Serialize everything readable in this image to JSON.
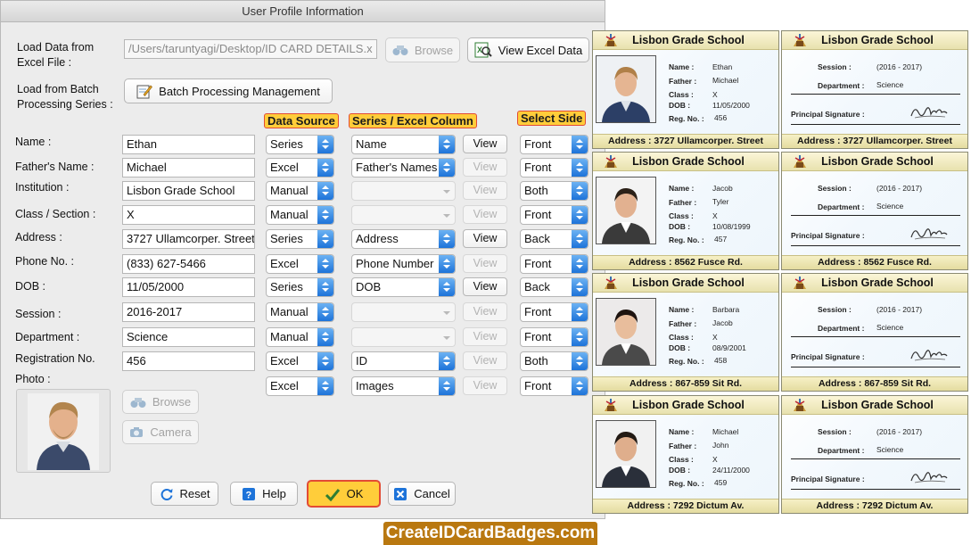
{
  "window": {
    "title": "User Profile Information"
  },
  "load_excel": {
    "label_line1": "Load Data from",
    "label_line2": "Excel File :",
    "path": "/Users/taruntyagi/Desktop/ID CARD DETAILS.x",
    "browse_label": "Browse",
    "view_label": "View Excel Data"
  },
  "batch": {
    "label_line1": "Load from Batch",
    "label_line2": "Processing Series :",
    "button_label": "Batch Processing Management"
  },
  "headers": {
    "data_source": "Data Source",
    "series_column": "Series / Excel Column",
    "select_side": "Select Side"
  },
  "fields": [
    {
      "label": "Name :",
      "value": "Ethan",
      "source": "Series",
      "column": "Name",
      "view": "View",
      "side": "Front"
    },
    {
      "label": "Father's Name :",
      "value": "Michael",
      "source": "Excel",
      "column": "Father's Names",
      "view": "View",
      "side": "Front"
    },
    {
      "label": "Institution :",
      "value": "Lisbon Grade School",
      "source": "Manual",
      "column": "",
      "view": "View",
      "side": "Both"
    },
    {
      "label": "Class / Section :",
      "value": "X",
      "source": "Manual",
      "column": "",
      "view": "View",
      "side": "Front"
    },
    {
      "label": "Address :",
      "value": "3727 Ullamcorper. Street",
      "source": "Series",
      "column": "Address",
      "view": "View",
      "side": "Back"
    },
    {
      "label": "Phone No. :",
      "value": "(833) 627-5466",
      "source": "Excel",
      "column": "Phone Number",
      "view": "View",
      "side": "Front"
    },
    {
      "label": "DOB :",
      "value": "11/05/2000",
      "source": "Series",
      "column": "DOB",
      "view": "View",
      "side": "Back"
    },
    {
      "label": "Session :",
      "value": "2016-2017",
      "source": "Manual",
      "column": "",
      "view": "View",
      "side": "Front"
    },
    {
      "label": "Department :",
      "value": "Science",
      "source": "Manual",
      "column": "",
      "view": "View",
      "side": "Front"
    },
    {
      "label": "Registration No.",
      "value": "456",
      "source": "Excel",
      "column": "ID",
      "view": "View",
      "side": "Both"
    },
    {
      "label": "Photo :",
      "value": "",
      "source": "Excel",
      "column": "Images",
      "view": "View",
      "side": "Front"
    }
  ],
  "photo": {
    "browse_label": "Browse",
    "camera_label": "Camera"
  },
  "buttons": {
    "reset": "Reset",
    "help": "Help",
    "ok": "OK",
    "cancel": "Cancel"
  },
  "card_labels": {
    "name": "Name :",
    "father": "Father :",
    "class": "Class :",
    "dob": "DOB :",
    "reg": "Reg. No. :",
    "session": "Session :",
    "department": "Department :",
    "signature": "Principal Signature :",
    "address": "Address :"
  },
  "cards": [
    {
      "school": "Lisbon Grade School",
      "name": "Ethan",
      "father": "Michael",
      "class": "X",
      "dob": "11/05/2000",
      "reg": "456",
      "address": "3727 Ullamcorper. Street",
      "session": "(2016 - 2017)",
      "department": "Science"
    },
    {
      "school": "Lisbon Grade School",
      "name": "Jacob",
      "father": "Tyler",
      "class": "X",
      "dob": "10/08/1999",
      "reg": "457",
      "address": "8562 Fusce Rd.",
      "session": "(2016 - 2017)",
      "department": "Science"
    },
    {
      "school": "Lisbon Grade School",
      "name": "Barbara",
      "father": "Jacob",
      "class": "X",
      "dob": "08/9/2001",
      "reg": "458",
      "address": "867-859 Sit Rd.",
      "session": "(2016 - 2017)",
      "department": "Science"
    },
    {
      "school": "Lisbon Grade School",
      "name": "Michael",
      "father": "John",
      "class": "X",
      "dob": "24/11/2000",
      "reg": "459",
      "address": "7292 Dictum Av.",
      "session": "(2016 - 2017)",
      "department": "Science"
    }
  ],
  "brand": {
    "text": "CreateIDCardBadges.com"
  },
  "colors": {
    "accent_blue": "#1d73d9",
    "header_yellow": "#ffcd3a",
    "brand_bar": "#b97810"
  }
}
